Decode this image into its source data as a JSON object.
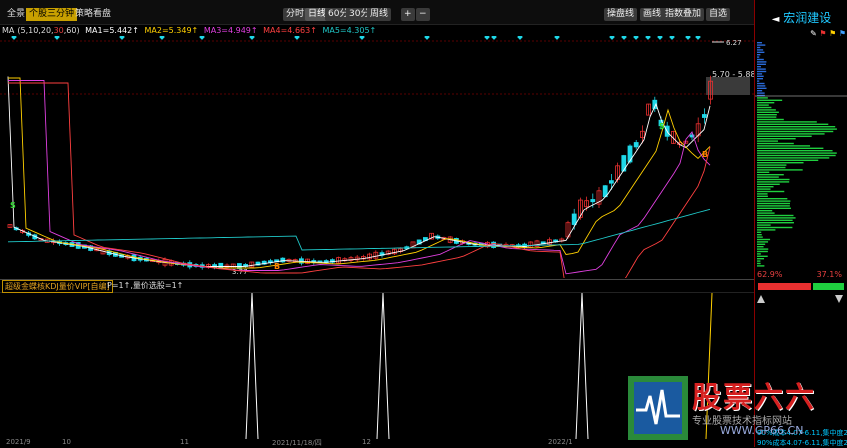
{
  "toolbar": {
    "tabs": [
      "全景",
      "个股三分钟",
      "策略看盘"
    ],
    "periods": [
      "分时",
      "日线",
      "60分",
      "30分",
      "周线"
    ],
    "active_period": "日线",
    "right_buttons": [
      "操盘线",
      "画线",
      "指数叠加",
      "自选"
    ],
    "plus": "+",
    "minus": "−",
    "prev": "◄",
    "next": "►"
  },
  "ma_line": {
    "label": "MA",
    "params": "(5,10,20,",
    "param30": "30",
    "param60": ",60)",
    "ma1": "MA1=5.442↑",
    "ma2": "MA2=5.349↑",
    "ma3": "MA3=4.949↑",
    "ma4": "MA4=4.663↑",
    "ma5": "MA5=4.305↑"
  },
  "price_labels": {
    "high": "6.27",
    "range": "5.70 - 5.88",
    "low": "3.77"
  },
  "signals": {
    "buy": "B",
    "sell": "S"
  },
  "indicator": {
    "name": "超级金蝶核KDJ量价VIP[自编]",
    "params": "P=1↑,量价选股=1↑"
  },
  "date_axis": {
    "labels": [
      "2021/9",
      "10",
      "11",
      "2021/11/18/四",
      "12",
      "2022/1"
    ]
  },
  "right_panel": {
    "stock_name": "宏润建设",
    "left_arrow": "◄",
    "right_arrow": "►",
    "pct_low": "62.9%",
    "pct_high": "37.1%",
    "line1": "90%成本4.07-6.11,集中度2",
    "line2": "90%成本4.07-6.11,集中度2"
  },
  "watermark": {
    "title": "股票六六",
    "subtitle": "专业股票技术指标网站",
    "url": "WWW.GP66.CN"
  },
  "colors": {
    "up": "#e83030",
    "down": "#1fd8e8",
    "ma1": "#ffffff",
    "ma2": "#ffd000",
    "ma3": "#e040e0",
    "ma4": "#ff4040",
    "ma5": "#20c8c8",
    "kline_volume_red": "#e83030",
    "chip_green": "#1fcf3f"
  }
}
